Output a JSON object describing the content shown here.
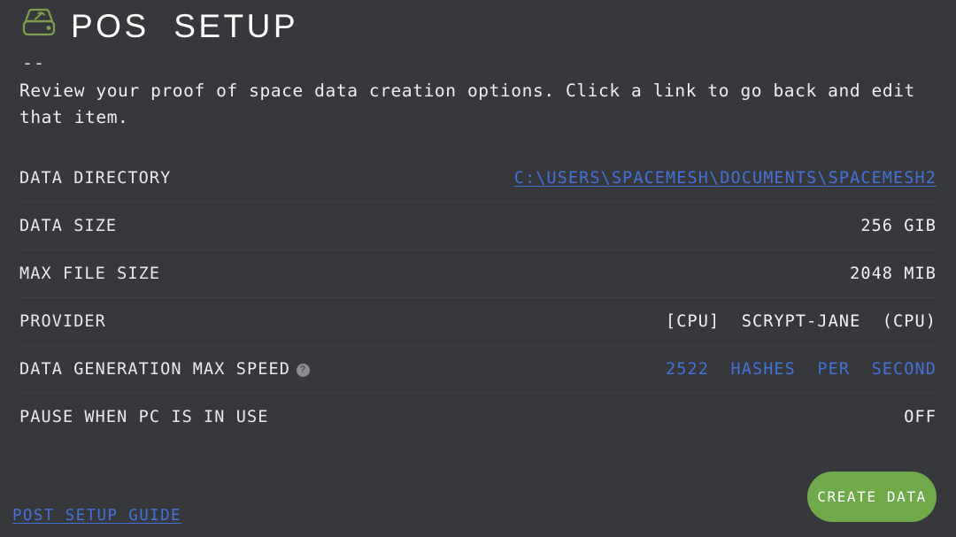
{
  "header": {
    "title": "POS  SETUP",
    "icon": "hard-drive-mining-icon",
    "icon_color": "#7d9e4f"
  },
  "separator": "--",
  "description": "Review your proof of space data creation options. Click a link to go back and edit that item.",
  "rows": [
    {
      "label": "DATA DIRECTORY",
      "value": "C:\\USERS\\SPACEMESH\\DOCUMENTS\\SPACEMESH2",
      "style": "link",
      "name": "data-directory"
    },
    {
      "label": "DATA SIZE",
      "value": "256 GIB",
      "style": "plain",
      "name": "data-size"
    },
    {
      "label": "MAX FILE SIZE",
      "value": "2048 MIB",
      "style": "plain",
      "name": "max-file-size"
    },
    {
      "label": "PROVIDER",
      "value": "[CPU]  SCRYPT-JANE  (CPU)",
      "style": "plain",
      "name": "provider"
    },
    {
      "label": "DATA GENERATION MAX SPEED",
      "value": "2522  HASHES  PER  SECOND",
      "style": "accent",
      "name": "data-generation-max-speed",
      "info_icon": "?"
    },
    {
      "label": "PAUSE WHEN PC IS IN USE",
      "value": "OFF",
      "style": "plain",
      "name": "pause-when-pc-in-use"
    }
  ],
  "footer": {
    "guide_link": "POST SETUP GUIDE",
    "create_button": "CREATE DATA"
  },
  "colors": {
    "background": "#37383c",
    "text": "#f0f0f2",
    "link": "#4271d8",
    "accent_green": "#6faa4a",
    "icon_green": "#7d9e4f",
    "divider": "#404146"
  }
}
